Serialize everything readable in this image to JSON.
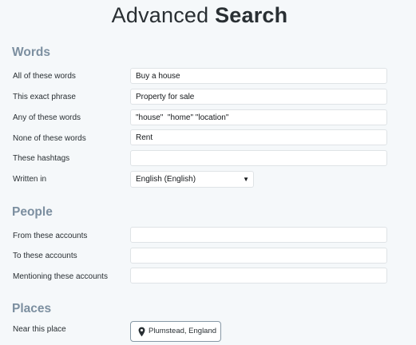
{
  "header": {
    "title_regular": "Advanced",
    "title_bold": "Search"
  },
  "words": {
    "section_title": "Words",
    "all_label": "All of these words",
    "all_value": "Buy a house",
    "exact_label": "This exact phrase",
    "exact_value": "Property for sale",
    "any_label": "Any of these words",
    "any_value": "\"house\"  \"home\" \"location\"",
    "none_label": "None of these words",
    "none_value": "Rent",
    "hashtags_label": "These hashtags",
    "hashtags_value": "",
    "written_in_label": "Written in",
    "language_selected": "English (English)"
  },
  "people": {
    "section_title": "People",
    "from_label": "From these accounts",
    "from_value": "",
    "to_label": "To these accounts",
    "to_value": "",
    "mentioning_label": "Mentioning these accounts",
    "mentioning_value": ""
  },
  "places": {
    "section_title": "Places",
    "near_label": "Near this place",
    "near_value": "Plumstead, England",
    "icon": "map-pin-icon"
  },
  "colors": {
    "background": "#f5f8fa",
    "section_title": "#7c8fa0",
    "input_border": "#dfe3e6",
    "text": "#292f33"
  }
}
